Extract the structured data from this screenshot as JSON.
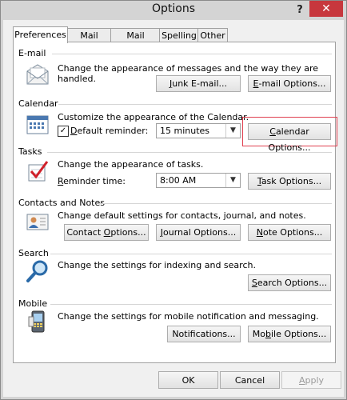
{
  "window": {
    "title": "Options",
    "help": "?",
    "close": "✕"
  },
  "tabs": [
    "Preferences",
    "Mail Setup",
    "Mail Format",
    "Spelling",
    "Other"
  ],
  "email": {
    "label": "E-mail",
    "desc": "Change the appearance of messages and the way they are handled.",
    "junk_btn_pre": "",
    "junk_btn_u": "J",
    "junk_btn_post": "unk E-mail...",
    "options_btn_pre": "",
    "options_btn_u": "E",
    "options_btn_post": "-mail Options..."
  },
  "calendar": {
    "label": "Calendar",
    "desc": "Customize the appearance of the Calendar.",
    "reminder_label_pre": "",
    "reminder_label_u": "D",
    "reminder_label_post": "efault reminder:",
    "reminder_value": "15 minutes",
    "options_btn_pre": "",
    "options_btn_u": "C",
    "options_btn_post": "alendar Options..."
  },
  "tasks": {
    "label": "Tasks",
    "desc": "Change the appearance of tasks.",
    "reminder_label_pre": "",
    "reminder_label_u": "R",
    "reminder_label_post": "eminder time:",
    "reminder_value": "8:00 AM",
    "options_btn_pre": "",
    "options_btn_u": "T",
    "options_btn_post": "ask Options..."
  },
  "contacts": {
    "label": "Contacts and Notes",
    "desc": "Change default settings for contacts, journal, and notes.",
    "contact_btn_pre": "Contact ",
    "contact_btn_u": "O",
    "contact_btn_post": "ptions...",
    "journal_btn_pre": "",
    "journal_btn_u": "J",
    "journal_btn_post": "ournal Options...",
    "note_btn_pre": "",
    "note_btn_u": "N",
    "note_btn_post": "ote Options..."
  },
  "search": {
    "label": "Search",
    "desc": "Change the settings for indexing and search.",
    "options_btn_pre": "",
    "options_btn_u": "S",
    "options_btn_post": "earch Options..."
  },
  "mobile": {
    "label": "Mobile",
    "desc": "Change the settings for mobile notification and messaging.",
    "notif_btn_pre": "Notifications",
    "notif_btn_u": "",
    "notif_btn_post": "...",
    "options_btn_pre": "Mo",
    "options_btn_u": "b",
    "options_btn_post": "ile Options..."
  },
  "footer": {
    "ok": "OK",
    "cancel": "Cancel",
    "apply_pre": "",
    "apply_u": "A",
    "apply_post": "pply"
  }
}
